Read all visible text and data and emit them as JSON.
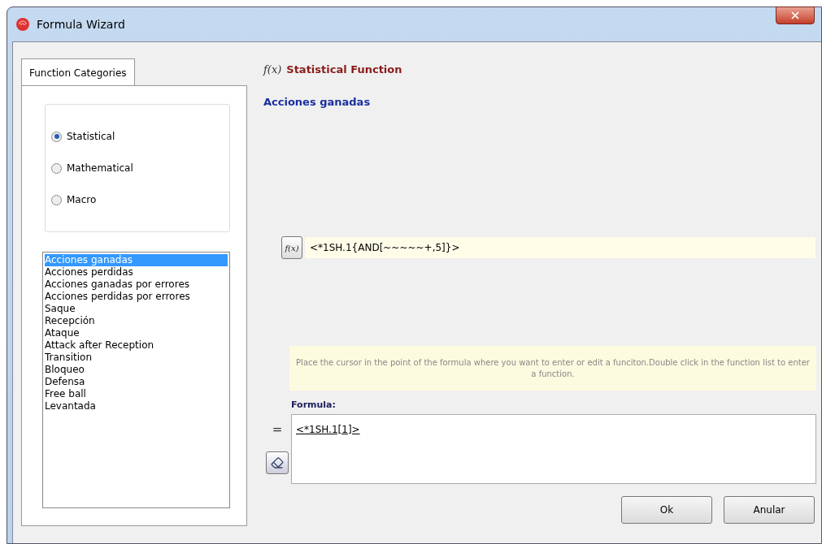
{
  "window": {
    "title": "Formula Wizard"
  },
  "tabs": [
    {
      "label": "Function Categories",
      "selected": true
    }
  ],
  "categories": [
    {
      "label": "Statistical",
      "selected": true
    },
    {
      "label": "Mathematical",
      "selected": false
    },
    {
      "label": "Macro",
      "selected": false
    }
  ],
  "functions": [
    {
      "label": "Acciones ganadas",
      "selected": true
    },
    {
      "label": "Acciones perdidas",
      "selected": false
    },
    {
      "label": "Acciones ganadas por errores",
      "selected": false
    },
    {
      "label": "Acciones perdidas por errores",
      "selected": false
    },
    {
      "label": "Saque",
      "selected": false
    },
    {
      "label": "Recepción",
      "selected": false
    },
    {
      "label": "Ataque",
      "selected": false
    },
    {
      "label": "Attack after Reception",
      "selected": false
    },
    {
      "label": "Transition",
      "selected": false
    },
    {
      "label": "Bloqueo",
      "selected": false
    },
    {
      "label": "Defensa",
      "selected": false
    },
    {
      "label": "Free ball",
      "selected": false
    },
    {
      "label": "Levantada",
      "selected": false
    }
  ],
  "header": {
    "icon": "f(x)",
    "title": "Statistical Function",
    "subtitle": "Acciones ganadas"
  },
  "function_row": {
    "icon": "f(x)",
    "value": "<*1SH.1{AND[~~~~~+,5]}>"
  },
  "hint": "Place the cursor in the point of the formula where you want to enter or edit a funciton.Double click in the function list to enter a function.",
  "formula": {
    "label": "Formula:",
    "equals": "=",
    "value": "<*1SH.1[1]>"
  },
  "buttons": [
    "Ok",
    "Anular"
  ]
}
